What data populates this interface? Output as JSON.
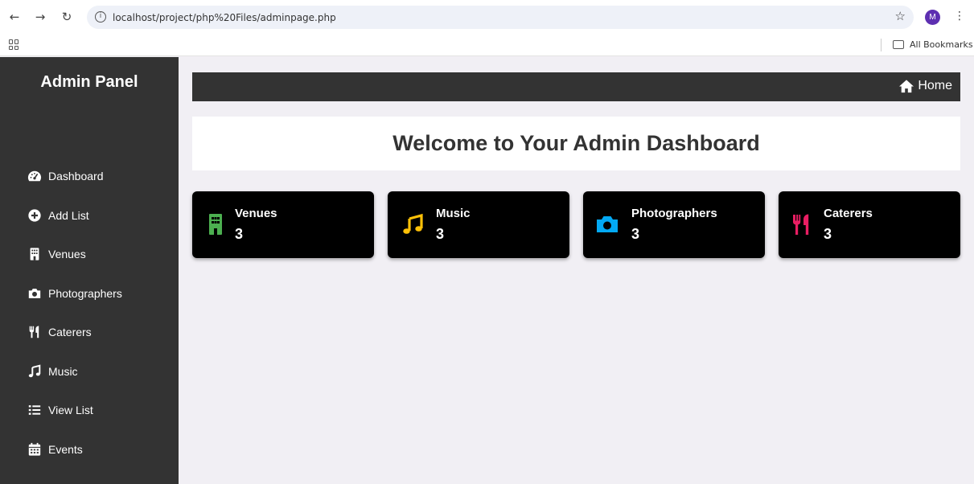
{
  "browser": {
    "url": "localhost/project/php%20Files/adminpage.php",
    "bookmarks_label": "All Bookmarks",
    "avatar_initial": "M"
  },
  "sidebar": {
    "title": "Admin Panel",
    "items": [
      {
        "label": "Dashboard",
        "icon": "gauge-icon"
      },
      {
        "label": "Add List",
        "icon": "plus-circle-icon"
      },
      {
        "label": "Venues",
        "icon": "building-icon"
      },
      {
        "label": "Photographers",
        "icon": "camera-icon"
      },
      {
        "label": "Caterers",
        "icon": "utensils-icon"
      },
      {
        "label": "Music",
        "icon": "music-icon"
      },
      {
        "label": "View List",
        "icon": "list-icon"
      },
      {
        "label": "Events",
        "icon": "calendar-icon"
      }
    ]
  },
  "header": {
    "home_label": "Home"
  },
  "main": {
    "welcome_title": "Welcome to Your Admin Dashboard",
    "cards": [
      {
        "label": "Venues",
        "count": "3",
        "icon": "building-icon",
        "color": "#4caf50"
      },
      {
        "label": "Music",
        "count": "3",
        "icon": "music-icon",
        "color": "#ffc107"
      },
      {
        "label": "Photographers",
        "count": "3",
        "icon": "camera-icon",
        "color": "#03a9f4"
      },
      {
        "label": "Caterers",
        "count": "3",
        "icon": "utensils-icon",
        "color": "#e91e63"
      }
    ]
  },
  "colors": {
    "sidebar_bg": "#333333",
    "page_bg": "#f1eff4",
    "card_bg": "#000000"
  }
}
